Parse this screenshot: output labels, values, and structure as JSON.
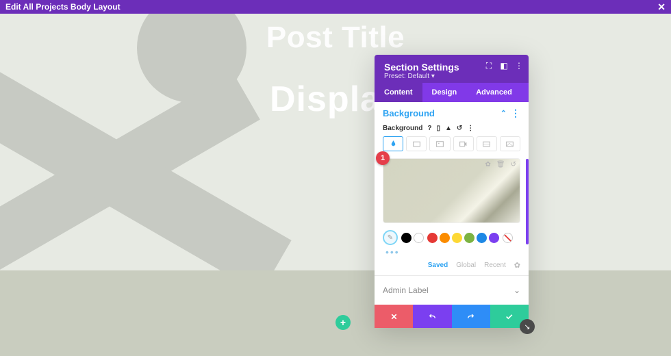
{
  "topbar": {
    "title": "Edit All Projects Body Layout"
  },
  "hero": {
    "line1": "Post Title",
    "line2": "Display"
  },
  "panel": {
    "title": "Section Settings",
    "preset_label": "Preset: Default",
    "tabs": {
      "content": "Content",
      "design": "Design",
      "advanced": "Advanced"
    },
    "background": {
      "heading": "Background",
      "option_label": "Background",
      "badge": "1",
      "palette_tabs": {
        "saved": "Saved",
        "global": "Global",
        "recent": "Recent"
      },
      "swatches": [
        "#000000",
        "#ffffff",
        "#e53935",
        "#fb8c00",
        "#fdd835",
        "#7cb342",
        "#1e88e5",
        "#7b3ff0"
      ]
    },
    "admin_label": "Admin Label"
  }
}
